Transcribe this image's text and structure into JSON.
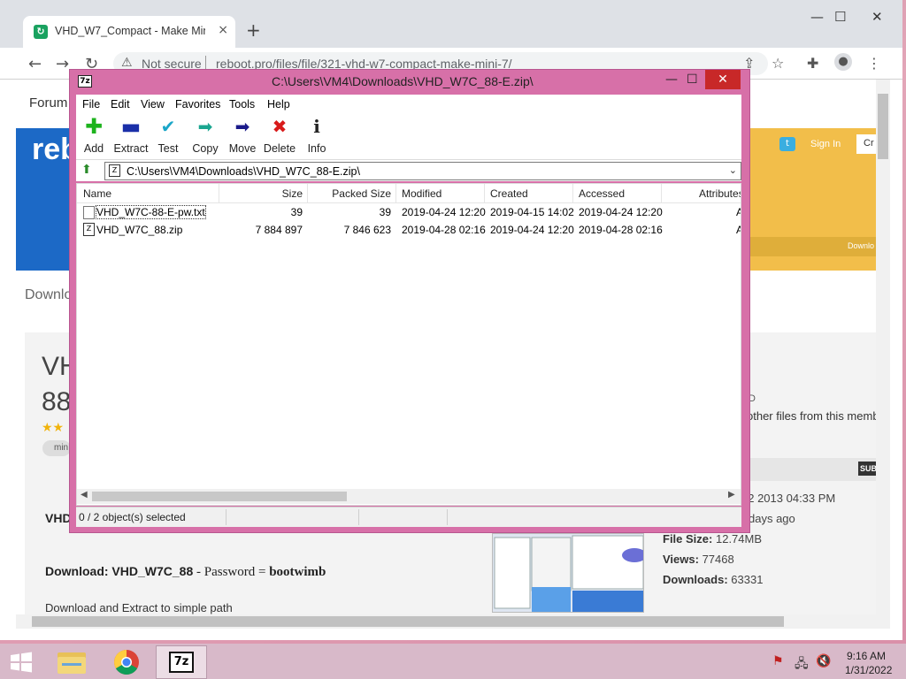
{
  "chrome": {
    "tab_title": "VHD_W7_Compact - Make Mini",
    "tab_close": "×",
    "new_tab": "+",
    "not_secure": "Not secure",
    "url": "reboot.pro/files/file/321-vhd-w7-compact-make-mini-7/",
    "win_min": "—",
    "win_max": "☐",
    "win_close": "✕"
  },
  "website": {
    "nav_forum": "Forum",
    "logo": "reb",
    "sign_in": "Sign In",
    "create": "Cr",
    "download_strip": "Downlo",
    "downloads_crumb": "Downlo",
    "title_line1": "VH",
    "title_line2": "88",
    "tag": "min",
    "side_text1": "D",
    "side_text2": "other files from this memb",
    "sub_badge": "SUB",
    "date_submitted": "02 2013 04:33 PM",
    "date_updated": "days ago",
    "file_size_label": "File Size:",
    "file_size": "12.74MB",
    "views_label": "Views:",
    "views": "77468",
    "downloads_label": "Downloads:",
    "downloads": "63331",
    "vhd_label": "VHD",
    "download_line_label": "Download: VHD_W7C_88",
    "download_line_mid": " - Password = ",
    "download_line_pw": "bootwimb",
    "extract_line": "Download and Extract to simple path"
  },
  "sevenzip": {
    "title": "C:\\Users\\VM4\\Downloads\\VHD_W7C_88-E.zip\\",
    "menu": [
      "File",
      "Edit",
      "View",
      "Favorites",
      "Tools",
      "Help"
    ],
    "toolbar": [
      "Add",
      "Extract",
      "Test",
      "Copy",
      "Move",
      "Delete",
      "Info"
    ],
    "path": "C:\\Users\\VM4\\Downloads\\VHD_W7C_88-E.zip\\",
    "columns": [
      "Name",
      "Size",
      "Packed Size",
      "Modified",
      "Created",
      "Accessed",
      "Attributes"
    ],
    "rows": [
      {
        "name": "VHD_W7C-88-E-pw.txt",
        "size": "39",
        "packed": "39",
        "modified": "2019-04-24 12:20",
        "created": "2019-04-15 14:02",
        "accessed": "2019-04-24 12:20",
        "attr": "A"
      },
      {
        "name": "VHD_W7C_88.zip",
        "size": "7 884 897",
        "packed": "7 846 623",
        "modified": "2019-04-28 02:16",
        "created": "2019-04-24 12:20",
        "accessed": "2019-04-28 02:16",
        "attr": "A"
      }
    ],
    "status": "0 / 2 object(s) selected"
  },
  "taskbar": {
    "sevenzip_label": "7z",
    "time": "9:16 AM",
    "date": "1/31/2022"
  },
  "colors": {
    "sevenzip_frame": "#d770a8",
    "banner": "#f2be4a",
    "banner_blue": "#1c69c6",
    "taskbar": "#d8b9c9"
  }
}
